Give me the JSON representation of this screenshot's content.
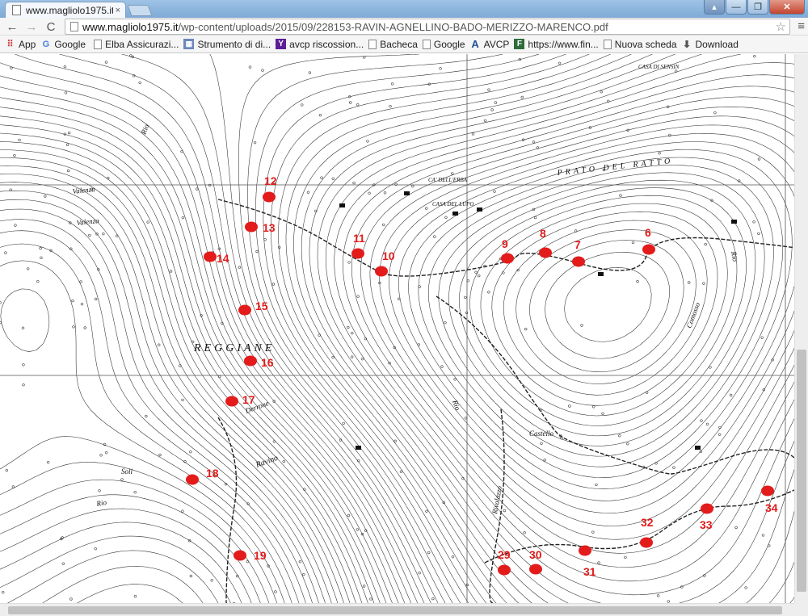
{
  "window": {
    "tab_title": "www.magliolo1975.it",
    "tab_close": "×",
    "user_btn": "▴",
    "min_btn": "—",
    "max_btn": "❐",
    "close_btn": "✕"
  },
  "toolbar": {
    "back_icon": "←",
    "forward_icon": "→",
    "reload_icon": "C",
    "url_host": "www.magliolo1975.it",
    "url_path": "/wp-content/uploads/2015/09/228153-RAVIN-AGNELLINO-BADO-MERIZZO-MARENCO.pdf",
    "star_icon": "☆",
    "menu_icon": "≡"
  },
  "bookmarks": [
    {
      "label": "App",
      "icon": "apps-icon"
    },
    {
      "label": "Google",
      "icon": "google-icon"
    },
    {
      "label": "Elba Assicurazi...",
      "icon": "page-icon"
    },
    {
      "label": "Strumento di di...",
      "icon": "tool-icon"
    },
    {
      "label": "avcp riscossion...",
      "icon": "yahoo-icon"
    },
    {
      "label": "Bacheca",
      "icon": "page-icon"
    },
    {
      "label": "Google",
      "icon": "page-icon"
    },
    {
      "label": "AVCP",
      "icon": "avcp-icon"
    },
    {
      "label": "https://www.fin...",
      "icon": "f-icon"
    },
    {
      "label": "Nuova scheda",
      "icon": "page-icon"
    },
    {
      "label": "Download",
      "icon": "download-icon"
    }
  ],
  "map": {
    "marker_color": "#e31b1b",
    "place_names": [
      "Valenza",
      "Valenza",
      "PRATO DEL RATTO",
      "CA' DELL'ERBA",
      "CASA DEL LUPO",
      "CASA DI SENSIN",
      "REGGIANE",
      "Castello",
      "Rio",
      "Rio",
      "Rio",
      "Ravino",
      "Soli",
      "Derrone",
      "Rivalazzo",
      "Comosso",
      "Rio"
    ],
    "markers": [
      {
        "label": "6"
      },
      {
        "label": "7"
      },
      {
        "label": "8"
      },
      {
        "label": "9"
      },
      {
        "label": "10"
      },
      {
        "label": "11"
      },
      {
        "label": "12"
      },
      {
        "label": "13"
      },
      {
        "label": "14"
      },
      {
        "label": "15"
      },
      {
        "label": "16"
      },
      {
        "label": "17"
      },
      {
        "label": "18"
      },
      {
        "label": "19"
      },
      {
        "label": "29"
      },
      {
        "label": "30"
      },
      {
        "label": "31"
      },
      {
        "label": "32"
      },
      {
        "label": "33"
      },
      {
        "label": "34"
      }
    ]
  }
}
